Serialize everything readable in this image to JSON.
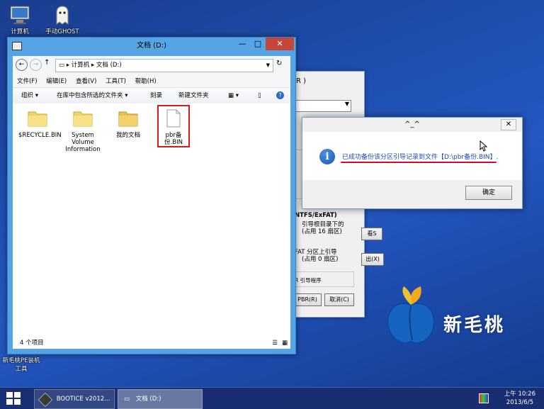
{
  "desktop": {
    "icons": [
      {
        "label": "计算机"
      },
      {
        "label": "手动GHOST"
      },
      {
        "label": "新毛桃PE装机工具"
      }
    ],
    "logo_text": "新毛桃"
  },
  "bootice_window": {
    "title_fragment": "R )",
    "lines": [
      "NTFS/ExFAT)",
      "引导根目录下的",
      "(占用 16 扇区)",
      "FAT 分区上引导",
      "(占用 0 扇区)",
      "R 引导程序"
    ],
    "btn_s": "看S",
    "btn_x": "出(X)",
    "btn_pbr": "PBR(R)",
    "btn_cancel": "取消(C)"
  },
  "explorer": {
    "title": "文档 (D:)",
    "address": [
      "计算机",
      "文档 (D:)"
    ],
    "menu": [
      "文件(F)",
      "编辑(E)",
      "查看(V)",
      "工具(T)",
      "帮助(H)"
    ],
    "commands": {
      "organize": "组织",
      "include": "在库中包含所选的文件夹",
      "burn": "刻录",
      "new_folder": "新建文件夹"
    },
    "files": [
      {
        "name": "$RECYCLE.BIN"
      },
      {
        "name": "System Volume Information"
      },
      {
        "name": "我的文档"
      },
      {
        "name": "pbr备份.BIN"
      }
    ],
    "status": "4 个项目"
  },
  "dialog": {
    "title": "^_^",
    "message": "已成功备份该分区引导记录到文件【D:\\pbr备份.BIN】.",
    "ok": "确定",
    "close": "✕"
  },
  "taskbar": {
    "items": [
      "BOOTICE v2012...",
      "文档 (D:)"
    ],
    "time": "上午 10:26",
    "date": "2013/6/5"
  },
  "colors": {
    "accent": "#55a4e6",
    "highlight_red": "#c8102e",
    "message_blue": "#2046b4"
  }
}
